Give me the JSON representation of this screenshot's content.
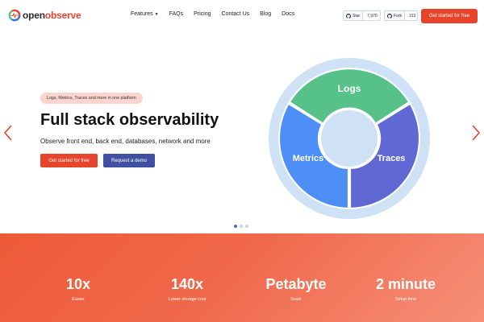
{
  "brand": {
    "name_part1": "open",
    "name_part2": "observe"
  },
  "nav": {
    "features": "Features",
    "faqs": "FAQs",
    "pricing": "Pricing",
    "contact": "Contact Us",
    "blog": "Blog",
    "docs": "Docs"
  },
  "github": {
    "star_label": "Star",
    "star_count": "7,970",
    "fork_label": "Fork",
    "fork_count": "313"
  },
  "header_cta": "Get started for free",
  "hero": {
    "pill": "Logs, Metrics, Traces and more in one platform",
    "title": "Full stack observability",
    "subtitle": "Observe front end, back end, databases, network and more",
    "primary_button": "Get started for free",
    "secondary_button": "Request a demo"
  },
  "diagram": {
    "segments": [
      {
        "label": "Logs",
        "color": "#57c18a"
      },
      {
        "label": "Traces",
        "color": "#6068d4"
      },
      {
        "label": "Metrics",
        "color": "#4d8ef7"
      }
    ],
    "ring_color": "#cfe1f5"
  },
  "carousel": {
    "slides": 3,
    "active": 1
  },
  "stats": [
    {
      "value": "10x",
      "label": "Easier"
    },
    {
      "value": "140x",
      "label": "Lower storage cost"
    },
    {
      "value": "Petabyte",
      "label": "Scale"
    },
    {
      "value": "2 minute",
      "label": "Setup time"
    }
  ],
  "colors": {
    "accent": "#e8442b",
    "secondary": "#3f4fa2"
  },
  "icons": [
    "openobserve-logo",
    "github-icon",
    "chevron-left-icon",
    "chevron-right-icon",
    "caret-down-icon"
  ]
}
